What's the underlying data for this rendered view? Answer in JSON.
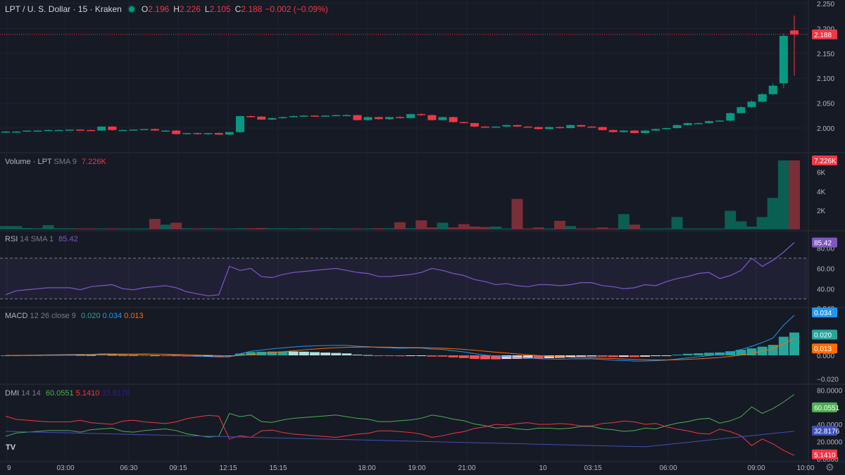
{
  "header": {
    "symbol": "LPT / U. S. Dollar · 15 · Kraken",
    "o_label": "O",
    "o": "2.196",
    "h_label": "H",
    "h": "2.226",
    "l_label": "L",
    "l": "2.105",
    "c_label": "C",
    "c": "2.188",
    "change": "−0.002 (−0.09%)"
  },
  "panes": {
    "volume": {
      "label": "Volume · LPT",
      "params": "SMA 9",
      "value": "7.226K"
    },
    "rsi": {
      "label": "RSI",
      "params": "14 SMA 1",
      "value": "85.42"
    },
    "macd": {
      "label": "MACD",
      "params": "12 26 close 9",
      "v1": "0.020",
      "v2": "0.034",
      "v3": "0.013"
    },
    "dmi": {
      "label": "DMI",
      "params": "14 14",
      "v1": "60.0551",
      "v2": "5.1410",
      "v3": "32.8176"
    }
  },
  "colors": {
    "up": "#089981",
    "down": "#f23645",
    "rsi": "#7e57c2",
    "macd": "#2962ff",
    "signal": "#ff6d00",
    "plus_di": "#4caf50",
    "minus_di": "#f23645",
    "adx": "#311b92"
  },
  "icons": {
    "logo": "tradingview-logo-icon",
    "settings": "gear-icon"
  },
  "chart_data": {
    "type": "candlestick",
    "price_axis": {
      "ticks": [
        "2.250",
        "2.200",
        "2.150",
        "2.100",
        "2.050",
        "2.000"
      ],
      "last_price": "2.188"
    },
    "time_axis": [
      "9",
      "03:00",
      "06:30",
      "09:15",
      "12:15",
      "15:15",
      "18:00",
      "19:00",
      "21:00",
      "10",
      "03:15",
      "06:00",
      "09:00",
      "10:00"
    ],
    "candles": [
      [
        1.993,
        1.994,
        1.99,
        1.992
      ],
      [
        1.992,
        1.994,
        1.99,
        1.993
      ],
      [
        1.993,
        1.995,
        1.991,
        1.995
      ],
      [
        1.995,
        1.996,
        1.993,
        1.996
      ],
      [
        1.996,
        1.997,
        1.994,
        1.996
      ],
      [
        1.996,
        1.997,
        1.995,
        1.997
      ],
      [
        1.997,
        1.998,
        1.996,
        1.997
      ],
      [
        1.997,
        1.999,
        1.995,
        1.998
      ],
      [
        1.998,
        2.0,
        1.996,
        1.998
      ],
      [
        1.998,
        2.001,
        1.997,
        2.0
      ],
      [
        2.0,
        2.004,
        1.998,
        2.003
      ],
      [
        2.003,
        2.004,
        1.997,
        1.997
      ],
      [
        1.997,
        1.998,
        1.995,
        1.996
      ],
      [
        1.996,
        1.998,
        1.995,
        1.997
      ],
      [
        1.997,
        1.999,
        1.996,
        1.998
      ],
      [
        1.998,
        1.999,
        1.996,
        1.998
      ],
      [
        1.998,
        1.999,
        1.996,
        1.997
      ],
      [
        1.997,
        1.999,
        1.995,
        1.998
      ],
      [
        1.998,
        1.999,
        1.996,
        1.998
      ],
      [
        1.998,
        1.999,
        1.997,
        1.998
      ],
      [
        1.998,
        1.999,
        1.996,
        1.998
      ],
      [
        1.998,
        2.0,
        1.996,
        1.999
      ],
      [
        1.999,
        2.0,
        1.997,
        1.999
      ],
      [
        1.999,
        2.0,
        1.997,
        1.999
      ],
      [
        1.999,
        2.0,
        1.997,
        1.999
      ],
      [
        1.999,
        2.0,
        1.997,
        1.999
      ],
      [
        1.999,
        2.0,
        1.997,
        1.999
      ],
      [
        1.999,
        2.0,
        1.997,
        1.999
      ],
      [
        1.999,
        2.0,
        1.997,
        1.999
      ],
      [
        1.999,
        2.0,
        1.997,
        1.999
      ],
      [
        1.999,
        2.0,
        1.997,
        1.999
      ],
      [
        1.999,
        2.0,
        1.997,
        1.999
      ],
      [
        1.999,
        2.0,
        1.997,
        1.999
      ],
      [
        1.999,
        2.0,
        1.997,
        1.999
      ],
      [
        1.999,
        2.0,
        1.997,
        1.999
      ],
      [
        1.999,
        2.0,
        1.997,
        1.999
      ],
      [
        1.999,
        2.0,
        1.997,
        1.999
      ],
      [
        1.999,
        2.0,
        1.997,
        1.999
      ],
      [
        1.999,
        2.0,
        1.997,
        1.999
      ],
      [
        1.999,
        2.0,
        1.997,
        1.999
      ]
    ],
    "closes": [
      1.993,
      1.993,
      1.995,
      1.995,
      1.996,
      1.996,
      1.997,
      1.996,
      1.995,
      2.003,
      1.996,
      1.996,
      1.997,
      1.998,
      1.995,
      1.995,
      1.988,
      1.99,
      1.988,
      1.99,
      1.987,
      1.992,
      2.024,
      2.023,
      2.017,
      2.02,
      2.022,
      2.024,
      2.025,
      2.024,
      2.025,
      2.026,
      2.026,
      2.016,
      2.022,
      2.018,
      2.022,
      2.02,
      2.028,
      2.026,
      2.016,
      2.022,
      2.012,
      2.01,
      2.003,
      2.002,
      2.003,
      2.006,
      2.003,
      2.002,
      1.998,
      2.002,
      2.0,
      2.006,
      2.003,
      2.002,
      1.996,
      1.992,
      1.995,
      1.99,
      1.995,
      1.998,
      2.0,
      2.006,
      2.01,
      2.01,
      2.014,
      2.015,
      2.03,
      2.042,
      2.053,
      2.068,
      2.085,
      2.185,
      2.188
    ],
    "candle_opens": [
      1.992,
      1.993,
      1.994,
      1.995,
      1.996,
      1.996,
      1.996,
      1.997,
      1.996,
      1.995,
      2.003,
      1.996,
      1.996,
      1.997,
      1.998,
      1.995,
      1.995,
      1.989,
      1.99,
      1.988,
      1.99,
      1.987,
      1.992,
      2.024,
      2.023,
      2.017,
      2.02,
      2.022,
      2.024,
      2.025,
      2.024,
      2.025,
      2.026,
      2.026,
      2.016,
      2.022,
      2.018,
      2.022,
      2.02,
      2.028,
      2.026,
      2.016,
      2.022,
      2.012,
      2.01,
      2.003,
      2.002,
      2.003,
      2.006,
      2.003,
      2.002,
      1.998,
      2.002,
      2.0,
      2.006,
      2.003,
      2.002,
      1.996,
      1.992,
      1.995,
      1.99,
      1.995,
      1.998,
      2.0,
      2.006,
      2.01,
      2.01,
      2.014,
      2.015,
      2.03,
      2.042,
      2.053,
      2.068,
      2.09,
      2.196
    ],
    "candle_highs": [
      1.994,
      1.994,
      1.995,
      1.996,
      1.997,
      1.997,
      1.997,
      1.998,
      1.997,
      2.004,
      2.004,
      1.997,
      1.997,
      1.998,
      1.999,
      1.996,
      1.996,
      1.99,
      1.991,
      1.99,
      1.991,
      1.992,
      2.025,
      2.025,
      2.024,
      2.021,
      2.023,
      2.025,
      2.026,
      2.026,
      2.026,
      2.027,
      2.028,
      2.027,
      2.023,
      2.023,
      2.023,
      2.024,
      2.029,
      2.03,
      2.027,
      2.023,
      2.023,
      2.013,
      2.011,
      2.004,
      2.004,
      2.007,
      2.007,
      2.004,
      2.003,
      2.003,
      2.003,
      2.007,
      2.007,
      2.004,
      2.003,
      1.997,
      1.996,
      1.996,
      1.996,
      1.999,
      2.001,
      2.007,
      2.011,
      2.011,
      2.015,
      2.016,
      2.031,
      2.044,
      2.056,
      2.07,
      2.09,
      2.19,
      2.226
    ],
    "candle_lows": [
      1.99,
      1.991,
      1.992,
      1.993,
      1.994,
      1.995,
      1.995,
      1.995,
      1.994,
      1.994,
      1.995,
      1.995,
      1.995,
      1.996,
      1.994,
      1.993,
      1.987,
      1.987,
      1.987,
      1.986,
      1.986,
      1.986,
      1.99,
      2.021,
      2.016,
      2.016,
      2.019,
      2.021,
      2.023,
      2.023,
      2.023,
      2.024,
      2.025,
      2.015,
      2.015,
      2.017,
      2.017,
      2.019,
      2.019,
      2.024,
      2.015,
      2.015,
      2.011,
      2.009,
      2.002,
      2.001,
      2.001,
      2.002,
      2.002,
      2.001,
      1.997,
      1.997,
      1.999,
      1.999,
      2.002,
      2.001,
      1.995,
      1.991,
      1.991,
      1.989,
      1.989,
      1.994,
      1.997,
      1.999,
      2.005,
      2.009,
      2.009,
      2.013,
      2.014,
      2.029,
      2.04,
      2.051,
      2.066,
      2.08,
      2.105
    ],
    "volumes": [
      0.35,
      0.35,
      0.15,
      0.12,
      0.45,
      0.12,
      0.12,
      0.1,
      0.1,
      0.1,
      0.1,
      0.1,
      0.1,
      0.1,
      1.1,
      0.5,
      0.7,
      0.12,
      0.1,
      0.12,
      0.1,
      0.1,
      0.12,
      0.12,
      0.15,
      0.12,
      0.12,
      0.1,
      0.12,
      0.1,
      0.12,
      0.1,
      0.1,
      0.1,
      0.1,
      0.12,
      0.12,
      0.75,
      0.12,
      0.95,
      0.2,
      0.7,
      0.2,
      0.55,
      0.3,
      0.25,
      0.3,
      0.1,
      3.2,
      0.1,
      0.2,
      0.1,
      0.9,
      0.35,
      0.1,
      0.1,
      0.2,
      0.1,
      1.6,
      0.5,
      0.1,
      0.1,
      0.1,
      1.3,
      0.1,
      0.1,
      0.1,
      0.1,
      1.95,
      0.85,
      0.3,
      1.3,
      3.3,
      7.226,
      7.226
    ],
    "volume_axis": [
      "6K",
      "4K",
      "2K"
    ],
    "rsi": [
      34,
      38,
      39,
      40,
      41,
      41,
      41,
      39,
      42,
      43,
      44,
      40,
      39,
      41,
      42,
      43,
      41,
      37,
      35,
      33,
      34,
      62,
      58,
      60,
      52,
      51,
      54,
      56,
      57,
      58,
      59,
      60,
      58,
      56,
      55,
      52,
      52,
      53,
      54,
      56,
      60,
      58,
      55,
      53,
      49,
      47,
      44,
      45,
      43,
      42,
      44,
      44,
      43,
      44,
      46,
      46,
      43,
      42,
      40,
      41,
      44,
      43,
      47,
      50,
      52,
      55,
      56,
      50,
      53,
      58,
      70,
      62,
      68,
      76,
      85.42
    ],
    "rsi_axis": [
      "80.00",
      "60.00",
      "40.00"
    ],
    "macd_axis": [
      "0.040",
      "0.020",
      "0.000",
      "−0.020"
    ],
    "dmi_axis": [
      "80.0000",
      "40.0000",
      "20.0000",
      "0.0000"
    ]
  }
}
